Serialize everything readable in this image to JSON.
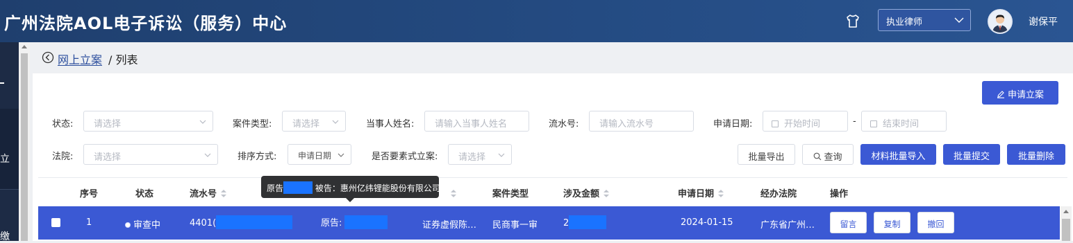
{
  "header": {
    "title": "广州法院AOL电子诉讼（服务）中心",
    "role_select": "执业律师",
    "user_name": "谢保平"
  },
  "sidenav": {
    "chars": [
      "立",
      "缴"
    ]
  },
  "breadcrumb": {
    "link": "网上立案",
    "current": "/ 列表"
  },
  "toolbar": {
    "apply_button": "申请立案"
  },
  "filters": {
    "status_label": "状态:",
    "status_placeholder": "请选择",
    "case_type_label": "案件类型:",
    "case_type_placeholder": "请选择",
    "party_name_label": "当事人姓名:",
    "party_name_placeholder": "请输入当事人姓名",
    "serial_label": "流水号:",
    "serial_placeholder": "请输入流水号",
    "apply_date_label": "申请日期:",
    "start_placeholder": "开始时间",
    "date_sep": "-",
    "end_placeholder": "结束时间",
    "court_label": "法院:",
    "court_placeholder": "请选择",
    "sort_label": "排序方式:",
    "sort_value": "申请日期",
    "elements_label": "是否要素式立案:",
    "elements_placeholder": "请选择"
  },
  "actions": {
    "export": "批量导出",
    "query": "查询",
    "import_materials": "材料批量导入",
    "batch_submit": "批量提交",
    "batch_delete": "批量删除"
  },
  "table": {
    "headers": [
      "序号",
      "状态",
      "流水号",
      "案件类型",
      "涉及金额",
      "申请日期",
      "经办法院",
      "操作"
    ],
    "rows": [
      {
        "index": "1",
        "status": "审查中",
        "serial_prefix": "4401(",
        "parties": "原告:",
        "cause": "证券虚假陈…",
        "case_type": "民商事一审",
        "amount_prefix": "2",
        "date": "2024-01-15",
        "court": "广东省广州…",
        "ops": [
          "留言",
          "复制",
          "撤回"
        ]
      }
    ]
  },
  "tooltip": {
    "plaintiff": "原告",
    "defendant": "被告：惠州亿纬锂能股份有限公司"
  },
  "colors": {
    "header": "#244b82",
    "primary": "#3b59d4",
    "mask": "#1a73ff"
  }
}
